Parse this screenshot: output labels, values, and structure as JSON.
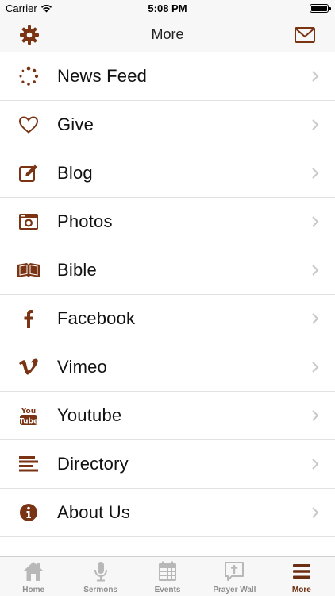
{
  "status_bar": {
    "carrier": "Carrier",
    "time": "5:08 PM"
  },
  "nav": {
    "title": "More",
    "settings_icon": "gear-icon",
    "mail_icon": "mail-icon"
  },
  "menu": {
    "items": [
      {
        "label": "News Feed",
        "icon": "spinner-dots-icon"
      },
      {
        "label": "Give",
        "icon": "heart-icon"
      },
      {
        "label": "Blog",
        "icon": "edit-icon"
      },
      {
        "label": "Photos",
        "icon": "camera-icon"
      },
      {
        "label": "Bible",
        "icon": "open-book-icon"
      },
      {
        "label": "Facebook",
        "icon": "facebook-icon"
      },
      {
        "label": "Vimeo",
        "icon": "vimeo-icon"
      },
      {
        "label": "Youtube",
        "icon": "youtube-icon"
      },
      {
        "label": "Directory",
        "icon": "list-icon"
      },
      {
        "label": "About Us",
        "icon": "info-icon"
      }
    ]
  },
  "tab_bar": {
    "tabs": [
      {
        "label": "Home",
        "icon": "home-icon"
      },
      {
        "label": "Sermons",
        "icon": "microphone-icon"
      },
      {
        "label": "Events",
        "icon": "calendar-icon"
      },
      {
        "label": "Prayer Wall",
        "icon": "prayer-cross-icon"
      },
      {
        "label": "More",
        "icon": "hamburger-menu-icon",
        "active": true
      }
    ]
  },
  "colors": {
    "accent": "#7a3413",
    "tab_inactive": "#b8b8b8",
    "chevron": "#c7c7cc"
  }
}
